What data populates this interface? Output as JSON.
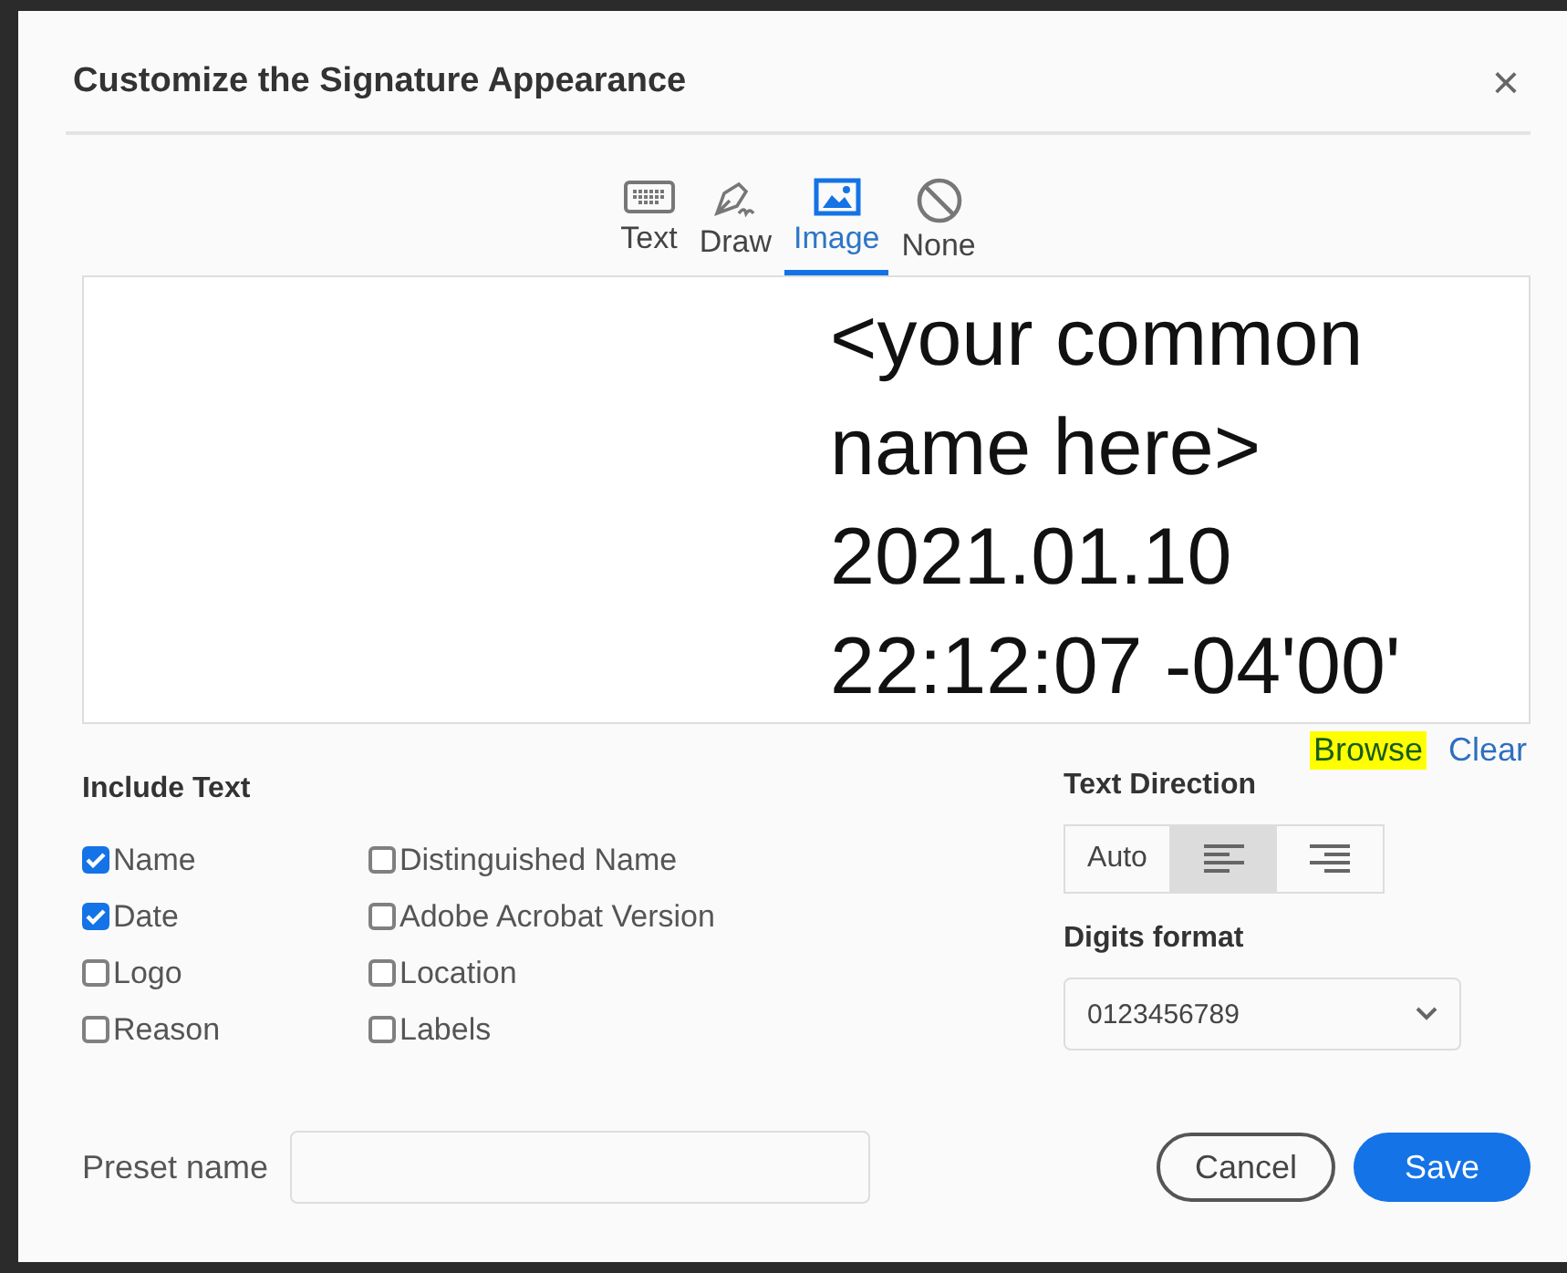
{
  "dialog": {
    "title": "Customize the Signature Appearance",
    "close": "×"
  },
  "modes": [
    {
      "label": "Text",
      "kind": "keyboard",
      "selected": false
    },
    {
      "label": "Draw",
      "kind": "pen",
      "selected": false
    },
    {
      "label": "Image",
      "kind": "image",
      "selected": true
    },
    {
      "label": "None",
      "kind": "none",
      "selected": false
    }
  ],
  "preview": {
    "lines": [
      "<your common",
      "name here>",
      "2021.01.10",
      "22:12:07 -04'00'"
    ]
  },
  "links": [
    {
      "label": "Browse",
      "highlighted": true
    },
    {
      "label": "Clear",
      "highlighted": false
    }
  ],
  "include_text": {
    "heading": "Include Text",
    "options": [
      {
        "label": "Name",
        "checked": true
      },
      {
        "label": "Date",
        "checked": true
      },
      {
        "label": "Logo",
        "checked": false
      },
      {
        "label": "Reason",
        "checked": false
      },
      {
        "label": "Distinguished Name",
        "checked": false
      },
      {
        "label": "Adobe Acrobat Version",
        "checked": false
      },
      {
        "label": "Location",
        "checked": false
      },
      {
        "label": "Labels",
        "checked": false
      }
    ]
  },
  "text_direction": {
    "heading": "Text Direction",
    "options": [
      {
        "kind": "text",
        "label": "Auto",
        "selected": false
      },
      {
        "kind": "align-left",
        "selected": true
      },
      {
        "kind": "align-right",
        "selected": false
      }
    ]
  },
  "digits_format": {
    "heading": "Digits format",
    "value": "0123456789"
  },
  "preset": {
    "label": "Preset name"
  },
  "buttons": [
    {
      "label": "Cancel",
      "kind": "secondary"
    },
    {
      "label": "Save",
      "kind": "primary"
    }
  ]
}
